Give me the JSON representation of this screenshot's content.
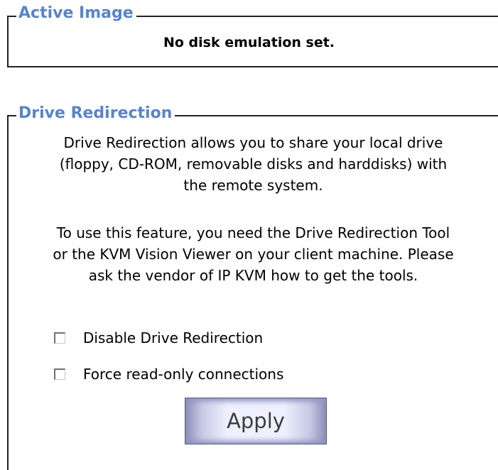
{
  "active_image": {
    "legend": "Active Image",
    "status": "No disk emulation set."
  },
  "drive_redirection": {
    "legend": "Drive Redirection",
    "description": [
      "Drive Redirection allows you to share your local drive",
      "(floppy, CD-ROM, removable disks and harddisks) with",
      "the remote system."
    ],
    "requirement": [
      "To use this feature, you need the Drive Redirection Tool",
      "or the KVM Vision Viewer on your client machine. Please",
      "ask the vendor of IP KVM how to get the tools."
    ],
    "options": [
      {
        "label": "Disable Drive Redirection",
        "checked": false
      },
      {
        "label": "Force read-only connections",
        "checked": false
      }
    ],
    "apply_label": "Apply"
  },
  "colors": {
    "legend_text": "#5a84c8",
    "border": "#222222",
    "button_face": "#eef0ff",
    "button_edge": "#8a8fb5"
  }
}
